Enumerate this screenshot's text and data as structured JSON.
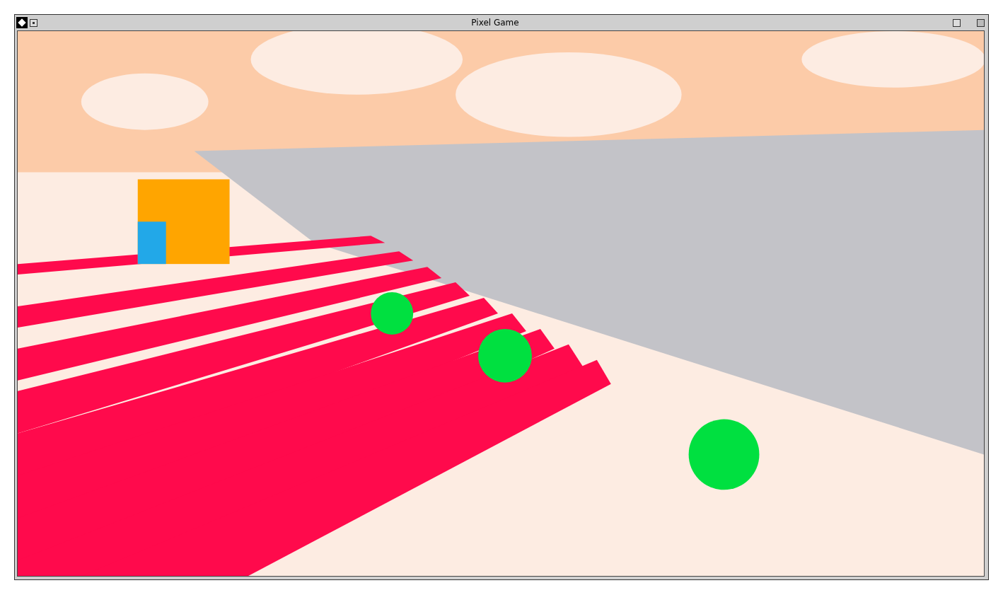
{
  "window": {
    "title": "Pixel Game"
  }
}
